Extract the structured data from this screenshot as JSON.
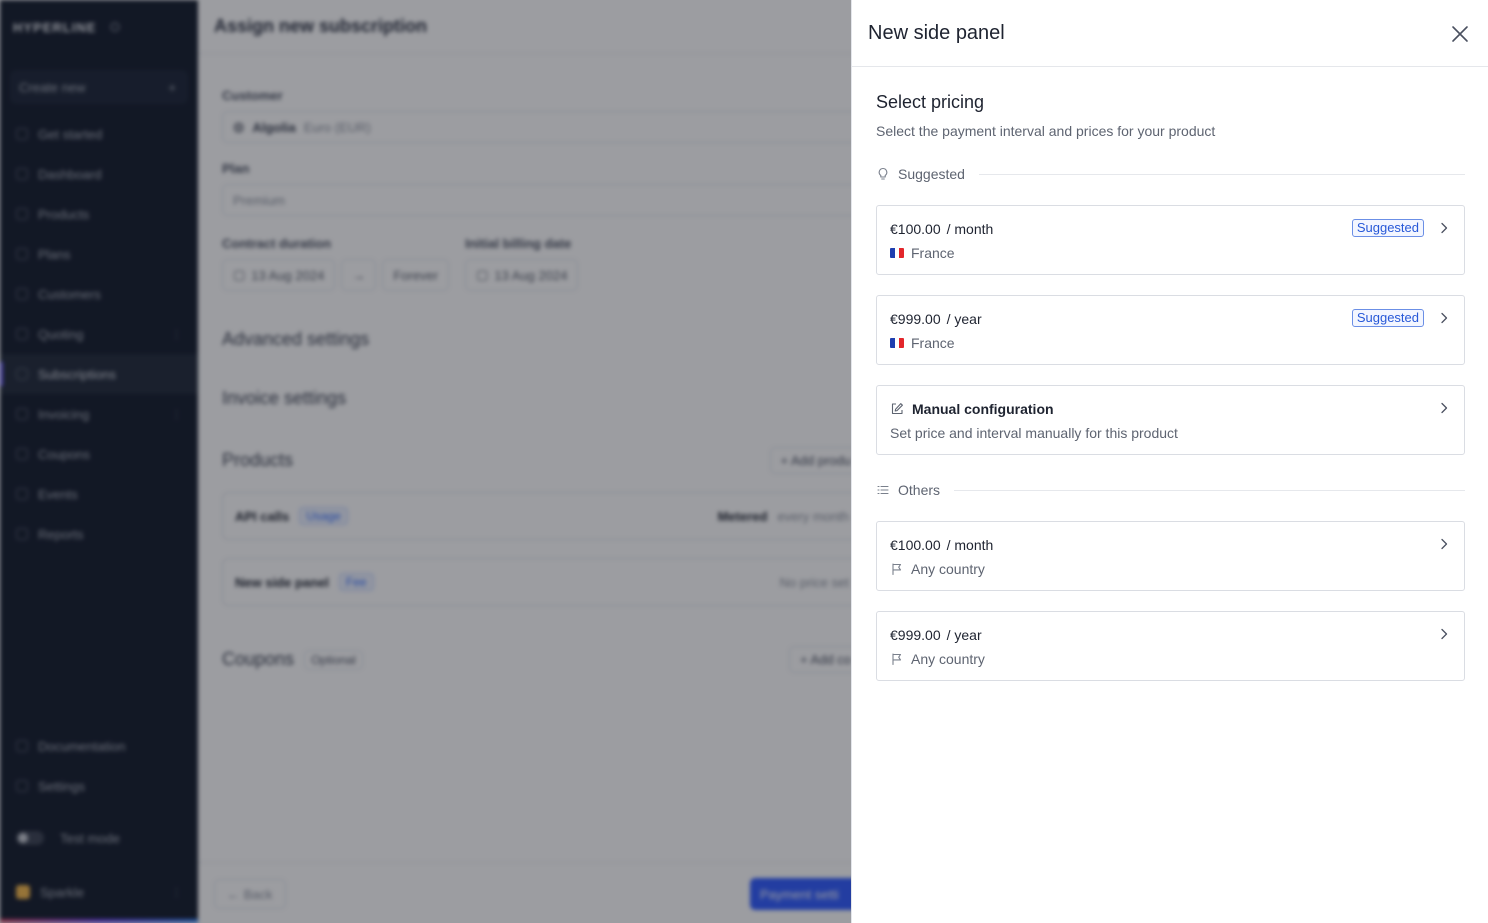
{
  "background": {
    "logo": "HYPERLINE",
    "create_new": "Create new",
    "nav": [
      "Get started",
      "Dashboard",
      "Products",
      "Plans",
      "Customers",
      "Quoting",
      "Subscriptions",
      "Invoicing",
      "Coupons",
      "Events",
      "Reports"
    ],
    "bottom_nav": [
      "Documentation",
      "Settings"
    ],
    "test_mode": "Test mode",
    "workspace": "Sparkle",
    "page_title": "Assign new subscription",
    "customer_label": "Customer",
    "customer_value": "Algolia",
    "customer_currency": "Euro (EUR)",
    "plan_label": "Plan",
    "plan_value": "Premium",
    "contract_label": "Contract duration",
    "contract_start": "13 Aug 2024",
    "contract_end": "Forever",
    "billing_label": "Initial billing date",
    "billing_date": "13 Aug 2024",
    "advanced": "Advanced settings",
    "invoice_settings": "Invoice settings",
    "products": "Products",
    "add_product": "+ Add produ",
    "product1_name": "API calls",
    "product1_tag": "Usage",
    "product1_meta": "Metered",
    "product1_interval": "every month",
    "product2_name": "New side panel",
    "product2_tag": "Fee",
    "product2_meta": "No price set",
    "coupons": "Coupons",
    "coupons_tag": "Optional",
    "add_coupon": "+ Add co",
    "back": "Back",
    "next": "Payment setti"
  },
  "panel": {
    "title": "New side panel",
    "heading": "Select pricing",
    "subheading": "Select the payment interval and prices for your product",
    "suggested_group": "Suggested",
    "others_group": "Others",
    "options": [
      {
        "price": "€100.00",
        "interval": "/ month",
        "region": "France",
        "badge": "Suggested"
      },
      {
        "price": "€999.00",
        "interval": "/ year",
        "region": "France",
        "badge": "Suggested"
      }
    ],
    "manual": {
      "title": "Manual configuration",
      "description": "Set price and interval manually for this product"
    },
    "others": [
      {
        "price": "€100.00",
        "interval": "/ month",
        "region": "Any country"
      },
      {
        "price": "€999.00",
        "interval": "/ year",
        "region": "Any country"
      }
    ]
  },
  "colors": {
    "accent": "#2758d8",
    "sidebar": "#121a2a",
    "flag_blue": "#1f3fb0",
    "flag_red": "#e3262b"
  }
}
